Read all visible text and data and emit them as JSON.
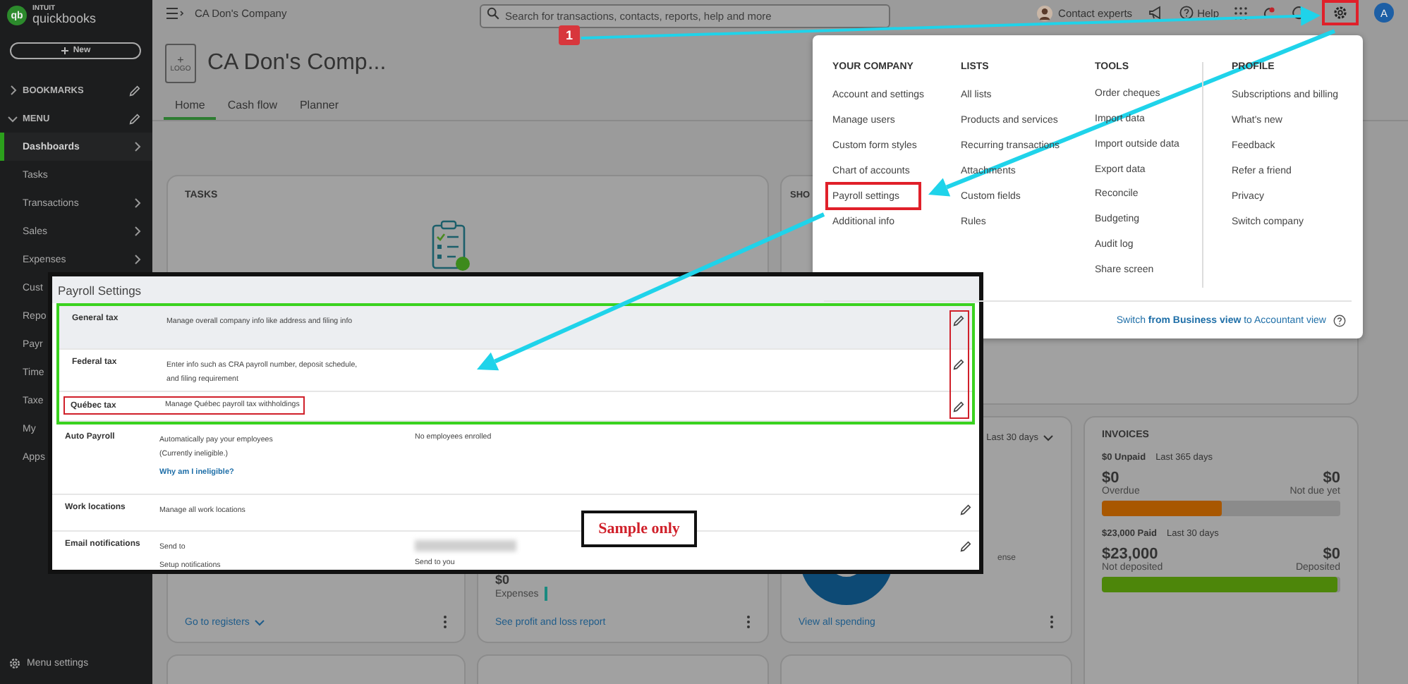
{
  "sidebar": {
    "logo": {
      "mark": "qb",
      "brand": "INTUIT",
      "product": "quickbooks"
    },
    "new_button": "New",
    "sections": [
      {
        "label": "BOOKMARKS",
        "expanded": false
      },
      {
        "label": "MENU",
        "expanded": true
      }
    ],
    "items": [
      {
        "label": "Dashboards",
        "selected": true,
        "has_submenu": true
      },
      {
        "label": "Tasks",
        "selected": false,
        "has_submenu": false
      },
      {
        "label": "Transactions",
        "selected": false,
        "has_submenu": true
      },
      {
        "label": "Sales",
        "selected": false,
        "has_submenu": true
      },
      {
        "label": "Expenses",
        "selected": false,
        "has_submenu": true
      },
      {
        "label": "Cust",
        "selected": false,
        "has_submenu": false
      },
      {
        "label": "Repo",
        "selected": false,
        "has_submenu": false
      },
      {
        "label": "Payr",
        "selected": false,
        "has_submenu": false
      },
      {
        "label": "Time",
        "selected": false,
        "has_submenu": false
      },
      {
        "label": "Taxe",
        "selected": false,
        "has_submenu": false
      },
      {
        "label": "My",
        "selected": false,
        "has_submenu": false
      },
      {
        "label": "Apps",
        "selected": false,
        "has_submenu": false
      }
    ],
    "footer": "Menu settings"
  },
  "topbar": {
    "company": "CA Don's Company",
    "search": {
      "placeholder": "Search for transactions, contacts, reports, help and more"
    },
    "contact": "Contact experts",
    "help": "Help",
    "avatar": "A"
  },
  "header": {
    "logo_plus": "+",
    "logo_label": "LOGO",
    "company": "CA Don's Comp...",
    "tabs": [
      {
        "label": "Home",
        "selected": true
      },
      {
        "label": "Cash flow",
        "selected": false
      },
      {
        "label": "Planner",
        "selected": false
      }
    ]
  },
  "cards": {
    "tasks": {
      "title": "TASKS"
    },
    "shortcuts": {
      "title": "SHO"
    },
    "accounts": {
      "link": "Go to registers"
    },
    "profit_loss": {
      "amount": "$0",
      "label": "Expenses",
      "link": "See profit and loss report"
    },
    "spending": {
      "period": "Last 30 days",
      "legend": "ense",
      "link": "View all spending"
    },
    "invoices": {
      "title": "INVOICES",
      "sections": [
        {
          "headline": "$0 Unpaid",
          "period": "Last 365 days",
          "left_amount": "$0",
          "left_label": "Overdue",
          "right_amount": "$0",
          "right_label": "Not due yet",
          "level": 0.5,
          "color": "#a85700"
        },
        {
          "headline": "$23,000 Paid",
          "period": "Last 30 days",
          "left_amount": "$23,000",
          "left_label": "Not deposited",
          "right_amount": "$0",
          "right_label": "Deposited",
          "level": 0.99,
          "color": "#4d860a"
        }
      ]
    }
  },
  "settings_menu": {
    "columns": [
      {
        "heading": "YOUR COMPANY",
        "items": [
          {
            "label": "Account and settings",
            "framed": false
          },
          {
            "label": "Manage users",
            "framed": false
          },
          {
            "label": "Custom form styles",
            "framed": false
          },
          {
            "label": "Chart of accounts",
            "framed": false
          },
          {
            "label": "Payroll settings",
            "framed": true
          },
          {
            "label": "Additional info",
            "framed": false
          }
        ]
      },
      {
        "heading": "LISTS",
        "items": [
          {
            "label": "All lists",
            "framed": false
          },
          {
            "label": "Products and services",
            "framed": false
          },
          {
            "label": "Recurring transactions",
            "framed": false
          },
          {
            "label": "Attachments",
            "framed": false
          },
          {
            "label": "Custom fields",
            "framed": false
          },
          {
            "label": "Rules",
            "framed": false
          }
        ]
      },
      {
        "heading": "TOOLS",
        "items": [
          {
            "label": "Order cheques",
            "framed": false
          },
          {
            "label": "Import data",
            "framed": false
          },
          {
            "label": "Import outside data",
            "framed": false
          },
          {
            "label": "Export data",
            "framed": false
          },
          {
            "label": "Reconcile",
            "framed": false
          },
          {
            "label": "Budgeting",
            "framed": false
          },
          {
            "label": "Audit log",
            "framed": false
          },
          {
            "label": "Share screen",
            "framed": false
          }
        ]
      },
      {
        "heading": "PROFILE",
        "items": [
          {
            "label": "Subscriptions and billing",
            "framed": false
          },
          {
            "label": "What's new",
            "framed": false
          },
          {
            "label": "Feedback",
            "framed": false
          },
          {
            "label": "Refer a friend",
            "framed": false
          },
          {
            "label": "Privacy",
            "framed": false
          },
          {
            "label": "Switch company",
            "framed": false
          }
        ]
      }
    ],
    "footer": "Switch **from Business view** to Accountant view"
  },
  "payroll_settings": {
    "title": "Payroll Settings",
    "tax_rows": [
      {
        "label": "General tax",
        "description": [
          "Manage overall company info like address and filing info"
        ],
        "highlighted": true,
        "framed": false,
        "editable": true
      },
      {
        "label": "Federal tax",
        "description": [
          "Enter info such as CRA payroll number, deposit schedule,",
          "and filing requirement"
        ],
        "highlighted": false,
        "framed": false,
        "editable": true
      },
      {
        "label": "Québec tax",
        "description": [
          "Manage Québec payroll tax withholdings"
        ],
        "highlighted": false,
        "framed": true,
        "editable": true
      }
    ],
    "rows": [
      {
        "label": "Auto Payroll",
        "description": [
          "Automatically pay your employees",
          "(Currently ineligible.)"
        ],
        "link": "Why am I ineligible?",
        "status": "No employees enrolled",
        "editable": false
      },
      {
        "label": "Work locations",
        "description": [
          "Manage all work locations"
        ],
        "editable": true
      },
      {
        "label": "Email notifications",
        "description": [
          "Send to"
        ],
        "note": "Setup notifications",
        "recipient_hidden": true,
        "status": "Send to you",
        "editable": true
      }
    ]
  },
  "annotations": {
    "step": "1",
    "note": "Sample only"
  }
}
